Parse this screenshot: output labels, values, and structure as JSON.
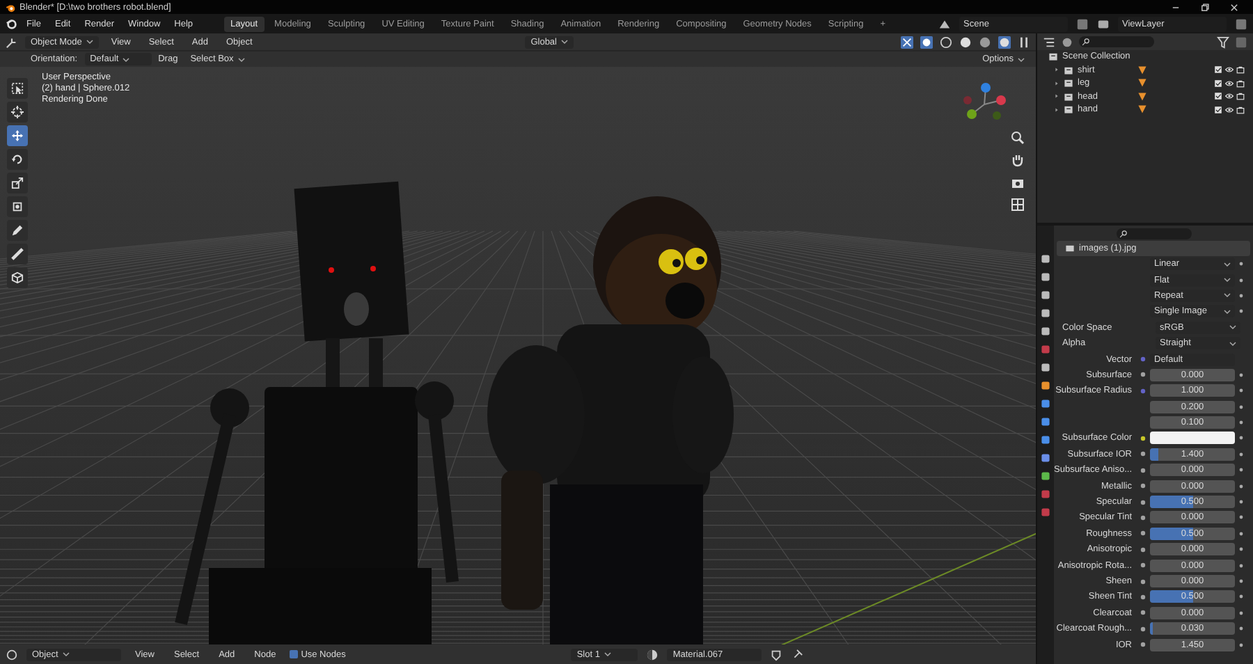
{
  "window": {
    "title": "Blender* [D:\\two brothers robot.blend]"
  },
  "menu": [
    "File",
    "Edit",
    "Render",
    "Window",
    "Help"
  ],
  "workspaces": [
    {
      "label": "Layout",
      "selected": true
    },
    {
      "label": "Modeling",
      "selected": false
    },
    {
      "label": "Sculpting",
      "selected": false
    },
    {
      "label": "UV Editing",
      "selected": false
    },
    {
      "label": "Texture Paint",
      "selected": false
    },
    {
      "label": "Shading",
      "selected": false
    },
    {
      "label": "Animation",
      "selected": false
    },
    {
      "label": "Rendering",
      "selected": false
    },
    {
      "label": "Compositing",
      "selected": false
    },
    {
      "label": "Geometry Nodes",
      "selected": false
    },
    {
      "label": "Scripting",
      "selected": false
    }
  ],
  "add_workspace": "+",
  "scene": "Scene",
  "view_layer": "ViewLayer",
  "viewport_header": {
    "mode": "Object Mode",
    "menus": [
      "View",
      "Select",
      "Add",
      "Object"
    ],
    "transform": "Global"
  },
  "tool_settings": {
    "orientation_label": "Orientation:",
    "orientation": "Default",
    "drag_label": "Drag",
    "drag": "Select Box",
    "options": "Options"
  },
  "toolbar": [
    {
      "kind": "select",
      "selected": false
    },
    {
      "kind": "cursor",
      "selected": false
    },
    {
      "kind": "move",
      "selected": true
    },
    {
      "kind": "rotate",
      "selected": false
    },
    {
      "kind": "scale",
      "selected": false
    },
    {
      "kind": "transform",
      "selected": false
    },
    {
      "kind": "annotate",
      "selected": false
    },
    {
      "kind": "measure",
      "selected": false
    },
    {
      "kind": "add",
      "selected": false
    }
  ],
  "viewport": {
    "overlay": [
      "User Perspective",
      "(2) hand | Sphere.012",
      "Rendering Done"
    ]
  },
  "outliner": {
    "root": "Scene Collection",
    "items": [
      {
        "name": "shirt"
      },
      {
        "name": "leg"
      },
      {
        "name": "head"
      },
      {
        "name": "hand"
      }
    ]
  },
  "properties": {
    "image": "images (1).jpg",
    "rows": [
      {
        "kind": "select",
        "value": "Linear"
      },
      {
        "kind": "select",
        "value": "Flat"
      },
      {
        "kind": "select",
        "value": "Repeat"
      },
      {
        "kind": "select",
        "value": "Single Image"
      },
      {
        "kind": "labeled-select",
        "label": "Color Space",
        "value": "sRGB"
      },
      {
        "kind": "labeled-select",
        "label": "Alpha",
        "value": "Straight"
      },
      {
        "kind": "link",
        "label": "Vector",
        "value": "Default"
      },
      {
        "kind": "value",
        "label": "Subsurface",
        "value": "0.000",
        "level": 0
      },
      {
        "kind": "vector",
        "label": "Subsurface Radius",
        "values": [
          "1.000",
          "0.200",
          "0.100"
        ]
      },
      {
        "kind": "color",
        "label": "Subsurface Color",
        "color": "#f2f2f2"
      },
      {
        "kind": "value",
        "label": "Subsurface IOR",
        "value": "1.400",
        "level": 0.1
      },
      {
        "kind": "value",
        "label": "Subsurface Aniso...",
        "value": "0.000",
        "level": 0
      },
      {
        "kind": "value",
        "label": "Metallic",
        "value": "0.000",
        "level": 0
      },
      {
        "kind": "value",
        "label": "Specular",
        "value": "0.500",
        "level": 0.5
      },
      {
        "kind": "value",
        "label": "Specular Tint",
        "value": "0.000",
        "level": 0
      },
      {
        "kind": "value",
        "label": "Roughness",
        "value": "0.500",
        "level": 0.5
      },
      {
        "kind": "value",
        "label": "Anisotropic",
        "value": "0.000",
        "level": 0
      },
      {
        "kind": "value",
        "label": "Anisotropic Rota...",
        "value": "0.000",
        "level": 0
      },
      {
        "kind": "value",
        "label": "Sheen",
        "value": "0.000",
        "level": 0
      },
      {
        "kind": "value",
        "label": "Sheen Tint",
        "value": "0.500",
        "level": 0.5
      },
      {
        "kind": "value",
        "label": "Clearcoat",
        "value": "0.000",
        "level": 0
      },
      {
        "kind": "value",
        "label": "Clearcoat Rough...",
        "value": "0.030",
        "level": 0.03
      },
      {
        "kind": "value",
        "label": "IOR",
        "value": "1.450",
        "level": 0
      }
    ]
  },
  "node_header": {
    "object": "Object",
    "menus": [
      "View",
      "Select",
      "Add",
      "Node"
    ],
    "use_nodes": {
      "label": "Use Nodes",
      "checked": true
    },
    "slot": "Slot 1",
    "material": "Material.067"
  }
}
